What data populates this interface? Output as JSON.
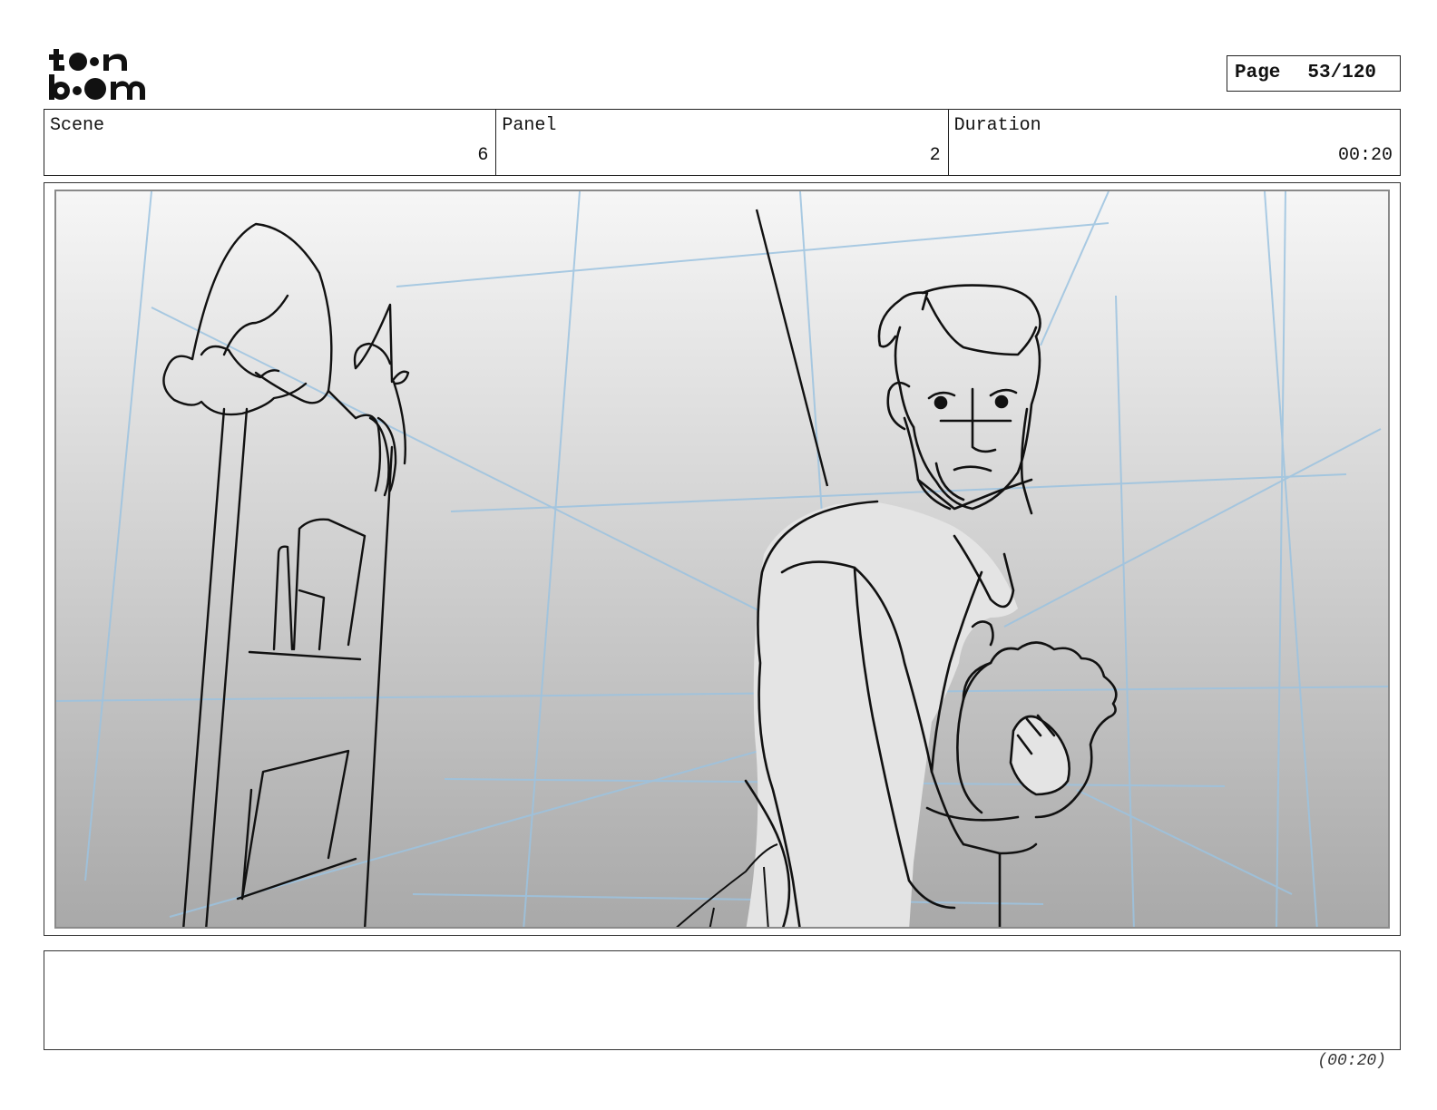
{
  "brand": {
    "logo_text": "toon boom"
  },
  "page": {
    "label": "Page",
    "number": "53/120"
  },
  "header": {
    "scene": {
      "label": "Scene",
      "value": "6"
    },
    "panel": {
      "label": "Panel",
      "value": "2"
    },
    "duration": {
      "label": "Duration",
      "value": "00:20"
    }
  },
  "notes": "",
  "footer": {
    "total_duration": "(00:20)"
  }
}
